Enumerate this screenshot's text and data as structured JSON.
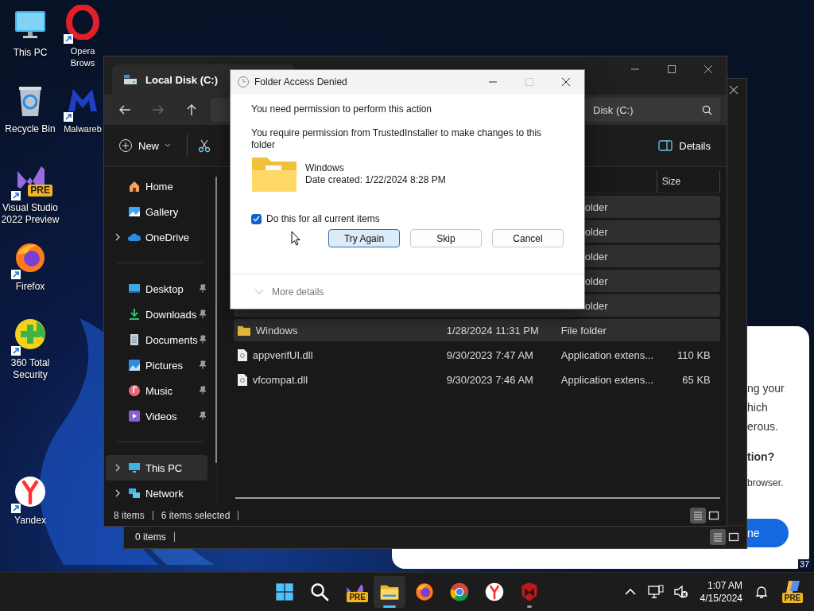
{
  "desktop": {
    "icons": [
      {
        "kind": "monitor",
        "label": "This PC",
        "shortcut": false
      },
      {
        "kind": "recycle-bin",
        "label": "Recycle Bin",
        "shortcut": false
      },
      {
        "kind": "visual-studio",
        "label": "Visual Studio 2022 Preview",
        "shortcut": true,
        "badge": "PRE"
      },
      {
        "kind": "firefox",
        "label": "Firefox",
        "shortcut": true
      },
      {
        "kind": "security-plus",
        "label": "360 Total Security",
        "shortcut": true
      },
      {
        "kind": "yandex",
        "label": "Yandex",
        "shortcut": true
      },
      {
        "kind": "opera",
        "label": "Opera Brows",
        "shortcut": true
      },
      {
        "kind": "malwarebytes",
        "label": "Malwareb",
        "shortcut": true
      }
    ]
  },
  "popup": {
    "lines": [
      "ng your",
      "hich",
      "erous."
    ],
    "question": "tion?",
    "note": "browser.",
    "button": "ne",
    "corner_text": "37"
  },
  "back_window": {
    "status": "0 items",
    "view_buttons": [
      {
        "kind": "details",
        "selected": true
      },
      {
        "kind": "tiles",
        "selected": false
      }
    ]
  },
  "explorer": {
    "title": "Local Disk (C:)",
    "search": {
      "placeholder": "Disk (C:)"
    },
    "toolbar": {
      "new": "New",
      "details": "Details"
    },
    "sidebar": [
      [
        {
          "kind": "home",
          "label": "Home",
          "expandable": false,
          "pinned": false,
          "selected": false
        },
        {
          "kind": "gallery",
          "label": "Gallery",
          "expandable": false,
          "pinned": false,
          "selected": false
        },
        {
          "kind": "cloud",
          "label": "OneDrive",
          "expandable": true,
          "pinned": false,
          "selected": false
        }
      ],
      [
        {
          "kind": "desktop",
          "label": "Desktop",
          "expandable": false,
          "pinned": true,
          "selected": false
        },
        {
          "kind": "downloads",
          "label": "Downloads",
          "expandable": false,
          "pinned": true,
          "selected": false
        },
        {
          "kind": "documents",
          "label": "Documents",
          "expandable": false,
          "pinned": true,
          "selected": false
        },
        {
          "kind": "pictures",
          "label": "Pictures",
          "expandable": false,
          "pinned": true,
          "selected": false
        },
        {
          "kind": "music",
          "label": "Music",
          "expandable": false,
          "pinned": true,
          "selected": false
        },
        {
          "kind": "videos",
          "label": "Videos",
          "expandable": false,
          "pinned": true,
          "selected": false
        }
      ],
      [
        {
          "kind": "pc",
          "label": "This PC",
          "expandable": true,
          "pinned": false,
          "selected": true
        },
        {
          "kind": "network",
          "label": "Network",
          "expandable": true,
          "pinned": false,
          "selected": false
        }
      ]
    ],
    "columns": [
      {
        "label": "Size"
      }
    ],
    "rows": [
      {
        "type": "older",
        "selected": true
      },
      {
        "type": "older",
        "selected": true
      },
      {
        "type": "older",
        "selected": true
      },
      {
        "type": "older",
        "selected": true
      },
      {
        "type": "older",
        "selected": true
      },
      {
        "kind": "folder",
        "name": "Windows",
        "date": "1/28/2024 11:31 PM",
        "type": "File folder",
        "selected": true
      },
      {
        "kind": "dll",
        "name": "appverifUI.dll",
        "date": "9/30/2023 7:47 AM",
        "type": "Application extens...",
        "size": "110 KB",
        "selected": false
      },
      {
        "kind": "dll",
        "name": "vfcompat.dll",
        "date": "9/30/2023 7:46 AM",
        "type": "Application extens...",
        "size": "65 KB",
        "selected": false
      }
    ],
    "status": {
      "count": "8 items",
      "selected": "6 items selected"
    },
    "view_buttons": [
      {
        "kind": "details",
        "selected": true
      },
      {
        "kind": "tiles",
        "selected": false
      }
    ]
  },
  "dialog": {
    "title": "Folder Access Denied",
    "heading": "You need permission to perform this action",
    "message": "You require permission from TrustedInstaller to make changes to this folder",
    "item": {
      "name": "Windows",
      "date": "Date created: 1/22/2024 8:28 PM"
    },
    "checkbox": {
      "label": "Do this for all current items",
      "checked": true
    },
    "buttons": [
      {
        "label": "Try Again",
        "default": true
      },
      {
        "label": "Skip",
        "default": false
      },
      {
        "label": "Cancel",
        "default": false
      }
    ],
    "more": "More details"
  },
  "taskbar": {
    "apps": [
      {
        "kind": "start",
        "active": false,
        "running": false
      },
      {
        "kind": "search",
        "active": false,
        "running": false
      },
      {
        "kind": "visual-studio",
        "active": false,
        "running": false,
        "badge": "PRE"
      },
      {
        "kind": "explorer",
        "active": true,
        "running": true
      },
      {
        "kind": "firefox",
        "active": false,
        "running": false
      },
      {
        "kind": "chrome",
        "active": false,
        "running": false
      },
      {
        "kind": "yandex",
        "active": false,
        "running": false
      },
      {
        "kind": "mcafee",
        "active": false,
        "running": true
      }
    ],
    "tray": [
      {
        "kind": "chevron"
      },
      {
        "kind": "network"
      },
      {
        "kind": "volume-muted"
      }
    ],
    "time": "1:07 AM",
    "date": "4/15/2024",
    "copilot": {
      "badge": "PRE"
    }
  }
}
